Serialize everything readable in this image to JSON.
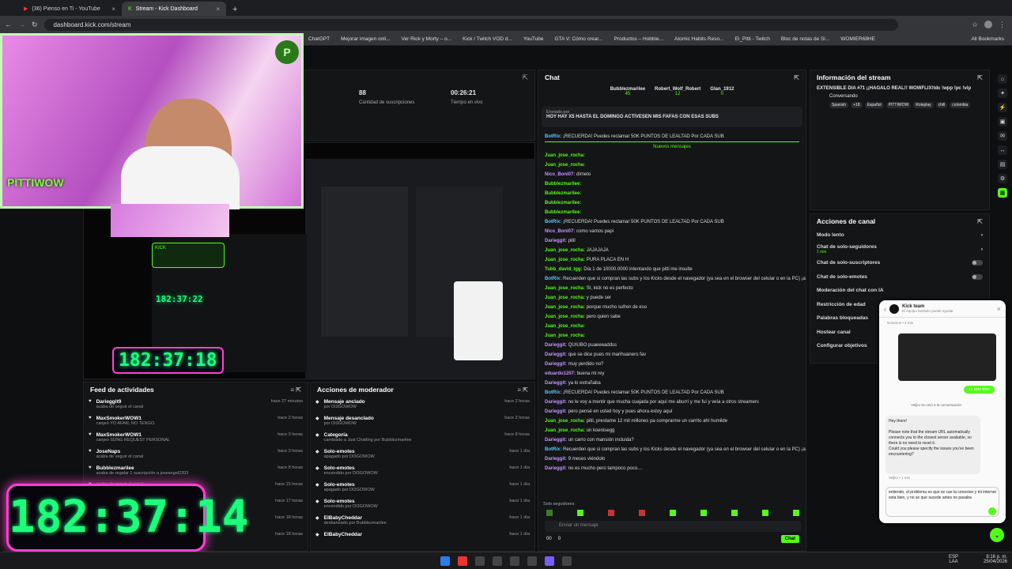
{
  "browser": {
    "tabs": [
      {
        "title": "(36) Pienso en Ti - YouTube"
      },
      {
        "title": "Stream - Kick Dashboard"
      }
    ],
    "url": "dashboard.kick.com/stream",
    "bookmarks": [
      "ChatGPT",
      "Mejorar imagen onli...",
      "Ver Rick y Morty – o...",
      "Kick / Twitch VOD d...",
      "YouTube",
      "GTA V: Cómo crear...",
      "Productos – Hobbie...",
      "Atomic Habits Reso...",
      "El_Pitti - Twitch",
      "Bloc de notas de Si...",
      "WOMIER68HE"
    ],
    "all_bookmarks": "All Bookmarks"
  },
  "stats": {
    "followers_value": "88",
    "followers_label": "Cantidad de suscripciones",
    "live_value": "00:26:21",
    "live_label": "Tiempo en vivo"
  },
  "chat": {
    "title": "Chat",
    "top_users": [
      {
        "name": "Bubblezmarilee",
        "count": "45"
      },
      {
        "name": "Robert_Wolf_Robert",
        "count": "12"
      },
      {
        "name": "Glan_1912",
        "count": "0"
      }
    ],
    "pinned_by": "Enviado por",
    "pinned": "HOY HAY X5 HASTA EL DOMINGO ACTIVESEN MIS FAFAS CON ESAS SUBS",
    "new_messages": "Nuevos mensajes",
    "messages": [
      {
        "u": "BotRix:",
        "t": "¡RECUERDA! Puedes reclamar 50K PUNTOS DE LEALTAD Por CADA SUB"
      },
      {
        "u": "Juan_jose_rocha:",
        "t": ""
      },
      {
        "u": "Juan_jose_rocha:",
        "t": ""
      },
      {
        "u": "Nico_Boni07:",
        "t": "dímelo"
      },
      {
        "u": "Bubblezmarilee:",
        "t": ""
      },
      {
        "u": "Bubblezmarilee:",
        "t": ""
      },
      {
        "u": "Bubblezmarilee:",
        "t": ""
      },
      {
        "u": "Bubblezmarilee:",
        "t": ""
      },
      {
        "u": "BotRix:",
        "t": "¡RECUERDA! Puedes reclamar 50K PUNTOS DE LEALTAD Por CADA SUB"
      },
      {
        "u": "Nico_Boni07:",
        "t": "como vamos papi"
      },
      {
        "u": "Darieggit:",
        "t": "pitil"
      },
      {
        "u": "Juan_jose_rocha:",
        "t": "JAJAJAJA"
      },
      {
        "u": "Juan_jose_rocha:",
        "t": "PURA PLACA EN H"
      },
      {
        "u": "Tubb_david_lgg:",
        "t": "Día 1 de 10000.0000 intentando que pitti me insulte"
      },
      {
        "u": "BotRix:",
        "t": "Recuerden que si compran las subs y los Kicks desde el navegador (ya sea en el browser del celular o en la PC) ¡ahorran bastante!"
      },
      {
        "u": "Juan_jose_rocha:",
        "t": "SI, kick no es perfecto"
      },
      {
        "u": "Juan_jose_rocha:",
        "t": "y puede ser"
      },
      {
        "u": "Juan_jose_rocha:",
        "t": "porque mucho sufren de eso"
      },
      {
        "u": "Juan_jose_rocha:",
        "t": "pero quien sabe"
      },
      {
        "u": "Juan_jose_rocha:",
        "t": ""
      },
      {
        "u": "Juan_jose_rocha:",
        "t": ""
      },
      {
        "u": "Darieggit:",
        "t": "QUIUBO puaeeeaddss"
      },
      {
        "u": "Darieggit:",
        "t": "que se dice pues mi marihuanero fav"
      },
      {
        "u": "Darieggit:",
        "t": "muy perdido no?"
      },
      {
        "u": "eduardo1207:",
        "t": "buena mi rey"
      },
      {
        "u": "Darieggit:",
        "t": "ya lo extrañaba"
      },
      {
        "u": "BotRix:",
        "t": "¡RECUERDA! Puedes reclamar 50K PUNTOS DE LEALTAD Por CADA SUB"
      },
      {
        "u": "Darieggit:",
        "t": "no le voy a mentir que mucha cuajada por aquí me aburrí y me fui y veía a otros streamers"
      },
      {
        "u": "Darieggit:",
        "t": "pero pensé en usted hoy y pues ahora estoy aquí"
      },
      {
        "u": "Juan_jose_rocha:",
        "t": "pitil, prestame 12 mil millones pa comprarme un carrito ahí humilde"
      },
      {
        "u": "Juan_jose_rocha:",
        "t": "un koenisegg"
      },
      {
        "u": "Darieggit:",
        "t": "un carro con mansión incluida?"
      },
      {
        "u": "BotRix:",
        "t": "Recuerden que si compran las subs y los Kicks desde el navegador (ya sea en el browser del celular o en la PC) ¡ahorran bastante!"
      },
      {
        "u": "Darieggit:",
        "t": "9 meses viéndolo"
      },
      {
        "u": "Darieggit:",
        "t": "no es mucho pero tampoco poco...."
      }
    ],
    "followers_only": "Solo seguidores",
    "input_placeholder": "Enviar un mensaje",
    "points": "00",
    "count": "0",
    "send": "Chat"
  },
  "info": {
    "title": "Información del stream",
    "stream_title": "EXTENSIBLE DIA #71 ¡¡HAGALO REAL!! WOWFLIX!tdc !wpp !pc !vip",
    "category": "Conversando",
    "tags": [
      "Spanish",
      "+18",
      "Español",
      "PITTIWOW",
      "Roleplay",
      "chill",
      "colombia"
    ]
  },
  "actions": {
    "title": "Acciones de canal",
    "items": [
      {
        "label": "Modo lento",
        "type": "arrow"
      },
      {
        "label": "Chat de solo-seguidores",
        "sub": "1 min",
        "type": "arrow"
      },
      {
        "label": "Chat de solo-suscriptores",
        "type": "toggle"
      },
      {
        "label": "Chat de solo-emotes",
        "type": "toggle"
      },
      {
        "label": "Moderación del chat con IA",
        "type": "none"
      },
      {
        "label": "Restricción de edad",
        "type": "none"
      },
      {
        "label": "Palabras bloqueadas",
        "type": "none"
      },
      {
        "label": "Hostear canal",
        "type": "none"
      },
      {
        "label": "Configurar objetivos",
        "type": "none"
      }
    ]
  },
  "feed": {
    "title": "Feed de actividades",
    "items": [
      {
        "name": "Darieggit9",
        "sub": "acaba de seguir el canal",
        "time": "hace 27 minutos"
      },
      {
        "name": "MaxSmokerWOW1",
        "sub": "canjeó YO AFAN, NO TENGO.",
        "time": "hace 2 horas"
      },
      {
        "name": "MaxSmokerWOW1",
        "sub": "canjeó SONG REQUEST PERSONAL",
        "time": "hace 3 horas"
      },
      {
        "name": "JoseNaps",
        "sub": "acaba de seguir el canal",
        "time": "hace 3 horas"
      },
      {
        "name": "Bubblezmarilee",
        "sub": "acaba de regalar 1 suscripción a joseangel2203",
        "time": "hace 8 horas"
      },
      {
        "name": "",
        "sub": "acaba de seguir el canal",
        "time": "hace 15 horas"
      },
      {
        "name": "",
        "sub": "",
        "time": "hace 17 horas"
      },
      {
        "name": "",
        "sub": "",
        "time": "hace 18 horas"
      },
      {
        "name": "",
        "sub": "",
        "time": "hace 18 horas"
      }
    ]
  },
  "mod": {
    "title": "Acciones de moderador",
    "items": [
      {
        "name": "Mensaje anclado",
        "sub": "por DI3GOWOW",
        "time": "hace 2 horas"
      },
      {
        "name": "Mensaje desanclado",
        "sub": "por DI3GOWOW",
        "time": "hace 2 horas"
      },
      {
        "name": "Categoría",
        "sub": "cambiado a Just Chatting por Bubblezmarilee",
        "time": "hace 8 horas"
      },
      {
        "name": "Solo-emotes",
        "sub": "apagado por DI3GOWOW",
        "time": "hace 1 día"
      },
      {
        "name": "Solo-emotes",
        "sub": "encendido por DI3GOWOW",
        "time": "hace 1 día"
      },
      {
        "name": "Solo-emotes",
        "sub": "apagado por DI3GOWOW",
        "time": "hace 1 día"
      },
      {
        "name": "Solo-emotes",
        "sub": "encendido por DI3GOWOW",
        "time": "hace 1 día"
      },
      {
        "name": "ElBabyCheddar",
        "sub": "desbaneado por Bubblezmarilee",
        "time": "hace 1 día"
      },
      {
        "name": "ElBabyCheddar",
        "sub": "",
        "time": "hace 1 día"
      }
    ]
  },
  "overlay": {
    "brand": "PITTIWOW",
    "kick_label": "KICK",
    "timer_small": "182:37:22",
    "timer_mid": "182:37:18",
    "timer_big": "182:37:14"
  },
  "support": {
    "name": "Kick team",
    "status": "El equipo también puede ayudar",
    "time1": "Nosotros • 4 min",
    "sent": "es esto bien",
    "joined": "Veljko se unió a la conversación",
    "msg": "Hey there!\n\nPlease note that the stream URL automatically connects you to the closest server available, so there is no need to reset it.\nCould you please specify the issues you've been encountering?",
    "time2": "Veljko • 1 min",
    "input": "entiendo, el problema es que se cae la conexion y mi internet esta bien, y no se que sucede antes no pasaba"
  },
  "taskbar": {
    "lang": "ESP",
    "lang2": "LAA",
    "time": "8:16 p. m.",
    "date": "25/04/2026"
  }
}
